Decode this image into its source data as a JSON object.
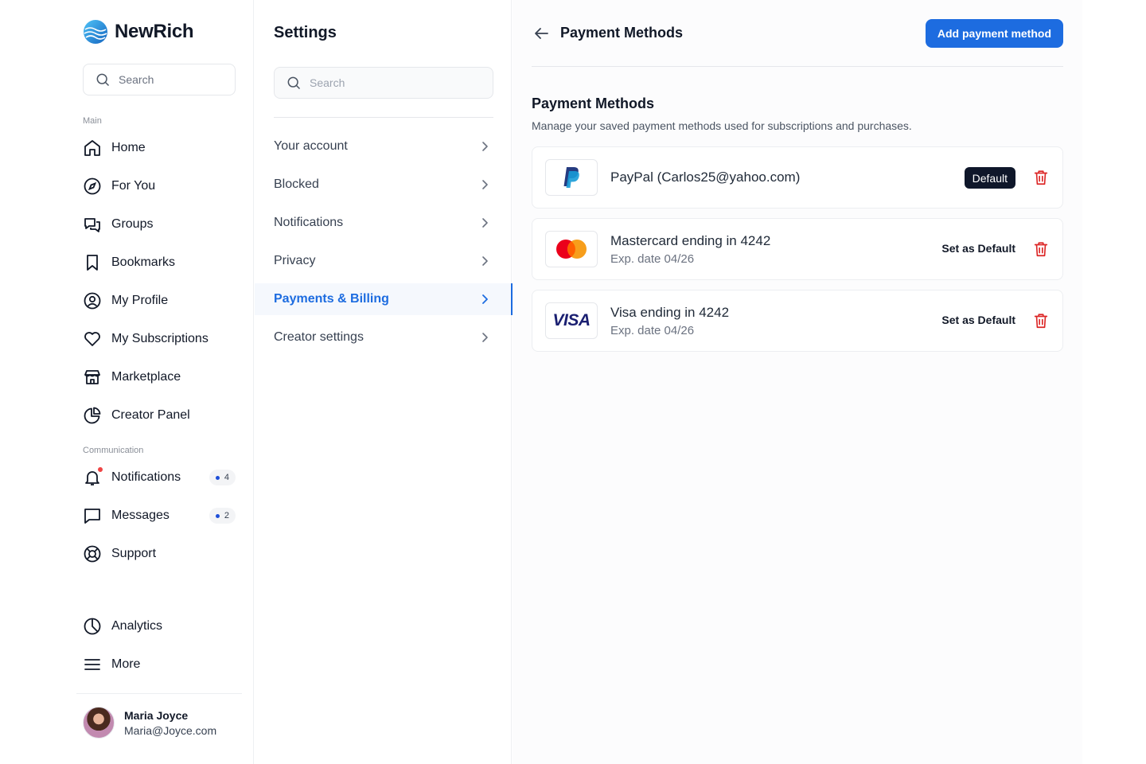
{
  "brand": {
    "name": "NewRich"
  },
  "sidebar": {
    "search_placeholder": "Search",
    "main_label": "Main",
    "main_items": [
      {
        "label": "Home",
        "icon": "home-icon"
      },
      {
        "label": "For You",
        "icon": "compass-icon"
      },
      {
        "label": "Groups",
        "icon": "chat-bubbles-icon"
      },
      {
        "label": "Bookmarks",
        "icon": "bookmark-icon"
      },
      {
        "label": "My Profile",
        "icon": "user-circle-icon"
      },
      {
        "label": "My Subscriptions",
        "icon": "heart-icon"
      },
      {
        "label": "Marketplace",
        "icon": "store-icon"
      },
      {
        "label": "Creator Panel",
        "icon": "pie-chart-icon"
      }
    ],
    "communication_label": "Communication",
    "communication_items": [
      {
        "label": "Notifications",
        "icon": "bell-icon",
        "count": "4"
      },
      {
        "label": "Messages",
        "icon": "message-icon",
        "count": "2"
      },
      {
        "label": "Support",
        "icon": "lifebuoy-icon"
      }
    ],
    "bottom_items": [
      {
        "label": "Analytics",
        "icon": "analytics-icon"
      },
      {
        "label": "More",
        "icon": "menu-icon"
      }
    ],
    "user": {
      "name": "Maria Joyce",
      "email": "Maria@Joyce.com"
    }
  },
  "settings": {
    "title": "Settings",
    "search_placeholder": "Search",
    "items": [
      {
        "label": "Your account"
      },
      {
        "label": "Blocked"
      },
      {
        "label": "Notifications"
      },
      {
        "label": "Privacy"
      },
      {
        "label": "Payments & Billing",
        "active": true
      },
      {
        "label": "Creator settings"
      }
    ]
  },
  "main": {
    "title": "Payment Methods",
    "add_button": "Add payment method",
    "section_title": "Payment Methods",
    "section_desc": "Manage your saved payment methods used for subscriptions and purchases.",
    "methods": [
      {
        "brand": "PayPal",
        "title": "PayPal (Carlos25@yahoo.com)",
        "default_label": "Default",
        "is_default": true
      },
      {
        "brand": "Mastercard",
        "title": "Mastercard ending in 4242",
        "expiry": "Exp. date 04/26",
        "action": "Set as Default"
      },
      {
        "brand": "Visa",
        "logo_text": "VISA",
        "title": "Visa ending in 4242",
        "expiry": "Exp. date 04/26",
        "action": "Set as Default"
      }
    ]
  },
  "colors": {
    "accent": "#1d6ce0",
    "danger": "#dc2626",
    "dark": "#0f172a"
  }
}
